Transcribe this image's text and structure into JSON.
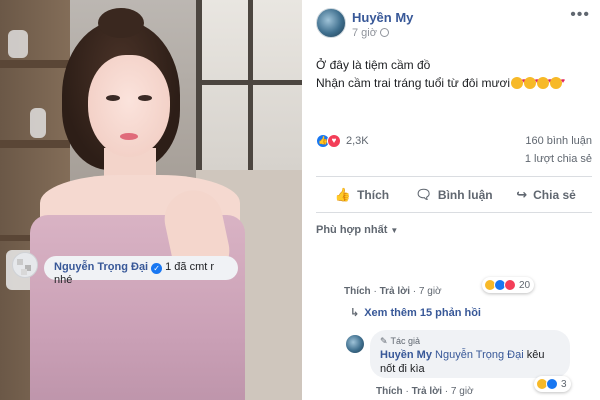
{
  "post": {
    "author": "Huyền My",
    "time": "7 giờ",
    "text_line1": "Ở đây là tiệm cầm đồ",
    "text_line2": "Nhận cầm trai tráng tuổi từ đôi mươi",
    "reactions_count": "2,3K",
    "comments_count": "160 bình luận",
    "shares_count": "1 lượt chia sẻ"
  },
  "actions": {
    "like": "Thích",
    "comment": "Bình luận",
    "share": "Chia sẻ"
  },
  "filter_label": "Phù hợp nhất",
  "comment1": {
    "name": "Nguyễn Trọng Đại",
    "text": "1 đã cmt r nhé",
    "reaction_count": "20",
    "like_label": "Thích",
    "reply_label": "Trả lời",
    "time": "7 giờ"
  },
  "more_replies": "Xem thêm 15 phản hồi",
  "reply1": {
    "badge": "Tác giả",
    "name": "Huyền My",
    "mention": "Nguyễn Trọng Đại",
    "text": "kêu nốt đi kìa",
    "reaction_count": "3",
    "like_label": "Thích",
    "reply_label": "Trả lời",
    "time": "7 giờ"
  },
  "icons": [
    "more-icon",
    "globe-icon",
    "like-icon",
    "love-icon",
    "comment-icon",
    "share-icon",
    "verified-icon",
    "haha-icon",
    "reply-arrow-icon",
    "pen-icon",
    "caret-down-icon"
  ],
  "colors": {
    "link": "#385898",
    "like": "#1877f2",
    "love": "#f33e58",
    "bubble": "#f0f2f5"
  }
}
